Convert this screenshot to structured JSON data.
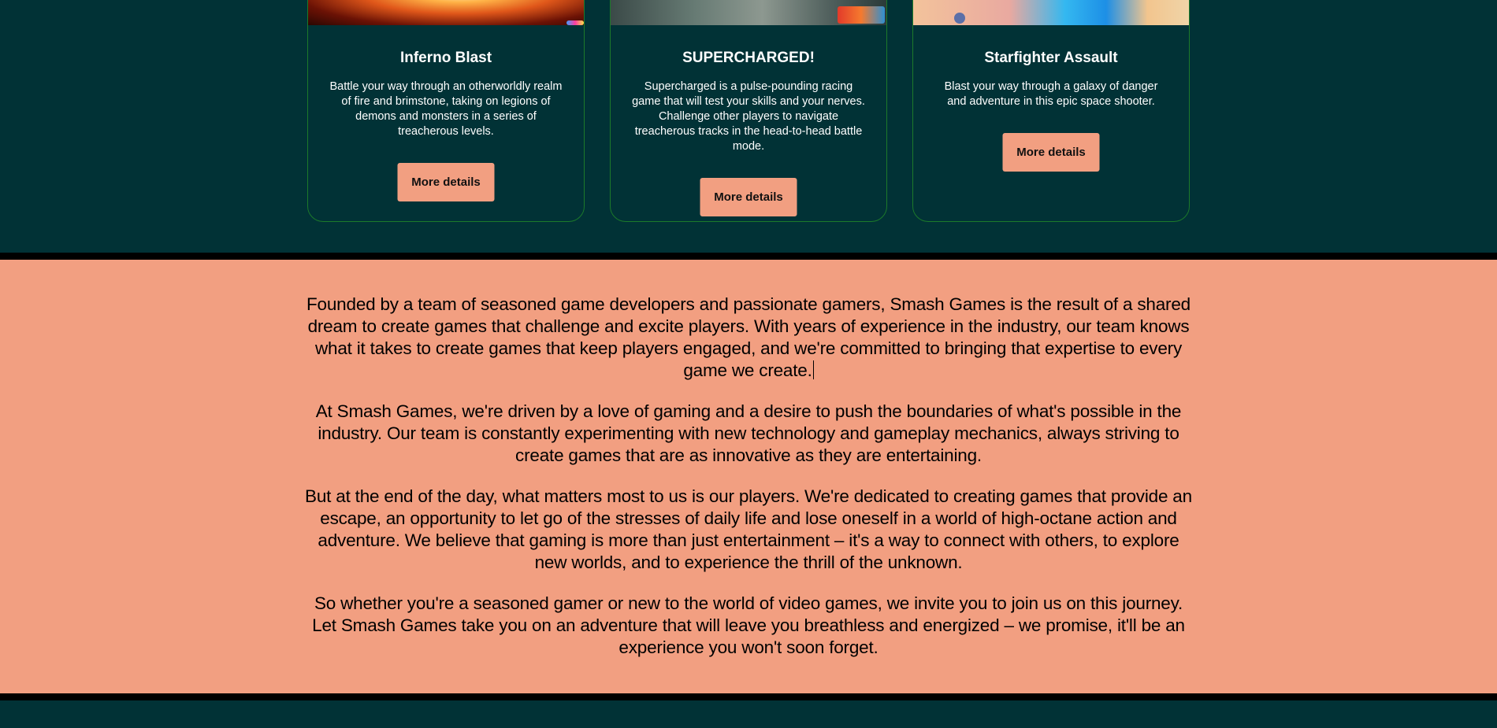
{
  "games": {
    "cards": [
      {
        "title": "Inferno Blast",
        "description": "Battle your way through an otherworldly realm of fire and brimstone, taking on legions of demons and monsters in a series of treacherous levels.",
        "button_label": "More details"
      },
      {
        "title": "SUPERCHARGED!",
        "description": "Supercharged is a pulse-pounding racing game that will test your skills and your nerves. Challenge other players to navigate treacherous tracks in the head-to-head battle mode.",
        "button_label": "More details"
      },
      {
        "title": "Starfighter Assault",
        "description": "Blast your way through a galaxy of danger and adventure in this epic space shooter.",
        "button_label": "More details"
      }
    ]
  },
  "about": {
    "paragraphs": [
      "Founded by a team of seasoned game developers and passionate gamers, Smash Games is the result of a shared dream to create games that challenge and excite players. With years of experience in the industry, our team knows what it takes to create games that keep players engaged, and we're committed to bringing that expertise to every game we create.",
      "At Smash Games, we're driven by a love of gaming and a desire to push the boundaries of what's possible in the industry. Our team is constantly experimenting with new technology and gameplay mechanics, always striving to create games that are as innovative as they are entertaining.",
      "But at the end of the day, what matters most to us is our players. We're dedicated to creating games that provide an escape, an opportunity to let go of the stresses of daily life and lose oneself in a world of high-octane action and adventure. We believe that gaming is more than just entertainment – it's a way to connect with others, to explore new worlds, and to experience the thrill of the unknown.",
      "So whether you're a seasoned gamer or new to the world of video games, we invite you to join us on this journey. Let Smash Games take you on an adventure that will leave you breathless and energized – we promise, it'll be an experience you won't soon forget."
    ]
  },
  "colors": {
    "dark_teal": "#013236",
    "salmon": "#f29f81",
    "card_border": "#1c7a2a",
    "divider": "#000000"
  }
}
